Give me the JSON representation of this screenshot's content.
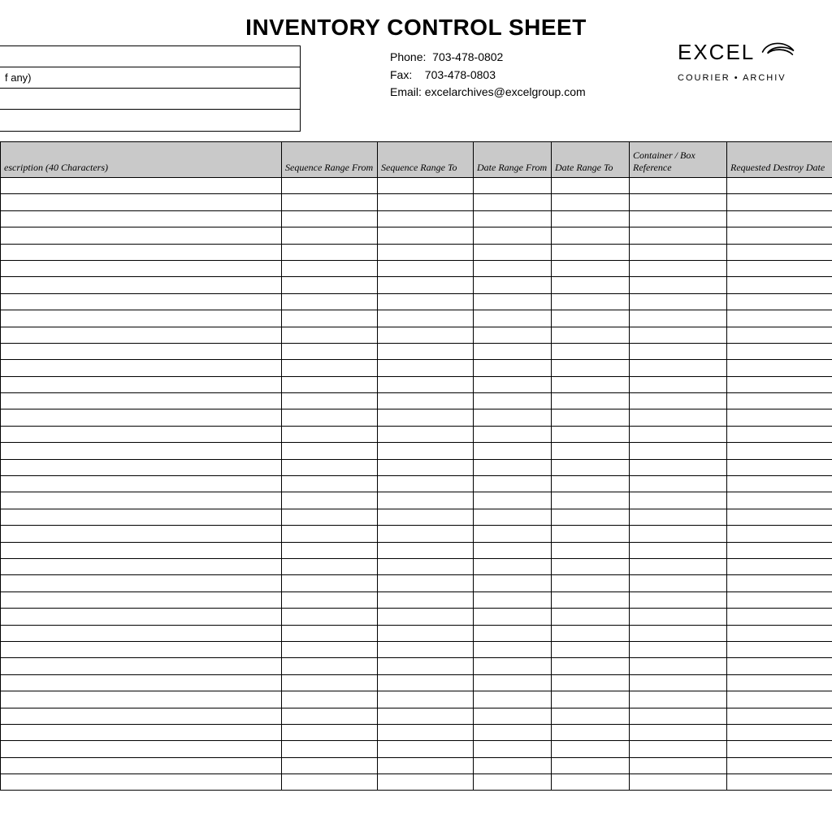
{
  "title": "INVENTORY CONTROL SHEET",
  "info_box": {
    "row1": "",
    "row2": "f any)",
    "row3": "",
    "row4": ""
  },
  "contact": {
    "phone_label": "Phone:",
    "phone": "703-478-0802",
    "fax_label": "Fax:",
    "fax": "703-478-0803",
    "email_label": "Email:",
    "email": "excelarchives@excelgroup.com"
  },
  "brand": {
    "name": "EXCEL",
    "tagline": "COURIER • ARCHIV"
  },
  "columns": [
    "escription (40 Characters)",
    "Sequence Range From",
    "Sequence Range To",
    "Date Range From",
    "Date Range To",
    "Container / Box Reference",
    "Requested Destroy Date"
  ],
  "row_count": 37
}
